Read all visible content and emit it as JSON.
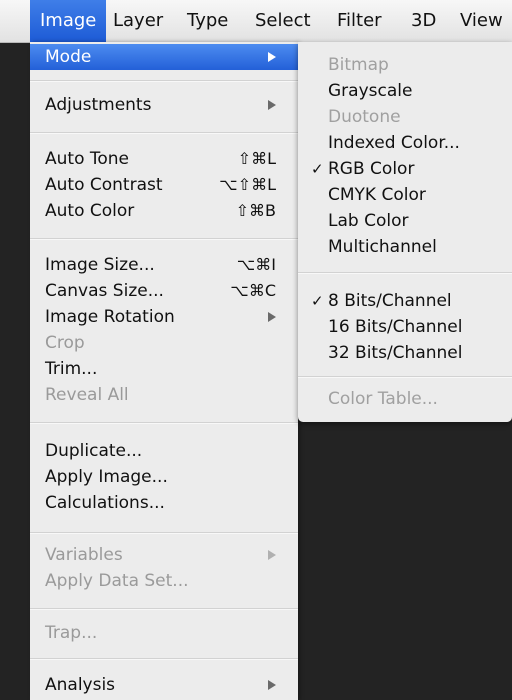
{
  "menubar": {
    "items": [
      {
        "label": "Image"
      },
      {
        "label": "Layer"
      },
      {
        "label": "Type"
      },
      {
        "label": "Select"
      },
      {
        "label": "Filter"
      },
      {
        "label": "3D"
      },
      {
        "label": "View"
      }
    ]
  },
  "image_menu": {
    "mode": "Mode",
    "adjustments": "Adjustments",
    "auto_tone": "Auto Tone",
    "auto_tone_shortcut": "⇧⌘L",
    "auto_contrast": "Auto Contrast",
    "auto_contrast_shortcut": "⌥⇧⌘L",
    "auto_color": "Auto Color",
    "auto_color_shortcut": "⇧⌘B",
    "image_size": "Image Size...",
    "image_size_shortcut": "⌥⌘I",
    "canvas_size": "Canvas Size...",
    "canvas_size_shortcut": "⌥⌘C",
    "image_rotation": "Image Rotation",
    "crop": "Crop",
    "trim": "Trim...",
    "reveal_all": "Reveal All",
    "duplicate": "Duplicate...",
    "apply_image": "Apply Image...",
    "calculations": "Calculations...",
    "variables": "Variables",
    "apply_data_set": "Apply Data Set...",
    "trap": "Trap...",
    "analysis": "Analysis"
  },
  "mode_submenu": {
    "bitmap": "Bitmap",
    "grayscale": "Grayscale",
    "duotone": "Duotone",
    "indexed_color": "Indexed Color...",
    "rgb_color": "RGB Color",
    "cmyk_color": "CMYK Color",
    "lab_color": "Lab Color",
    "multichannel": "Multichannel",
    "bits_8": "8 Bits/Channel",
    "bits_16": "16 Bits/Channel",
    "bits_32": "32 Bits/Channel",
    "color_table": "Color Table...",
    "checkmark": "✓"
  },
  "colors": {
    "highlight": "#2360d8",
    "menu_bg": "#ececec",
    "disabled_text": "#9a9a9a",
    "backdrop": "#232323"
  }
}
